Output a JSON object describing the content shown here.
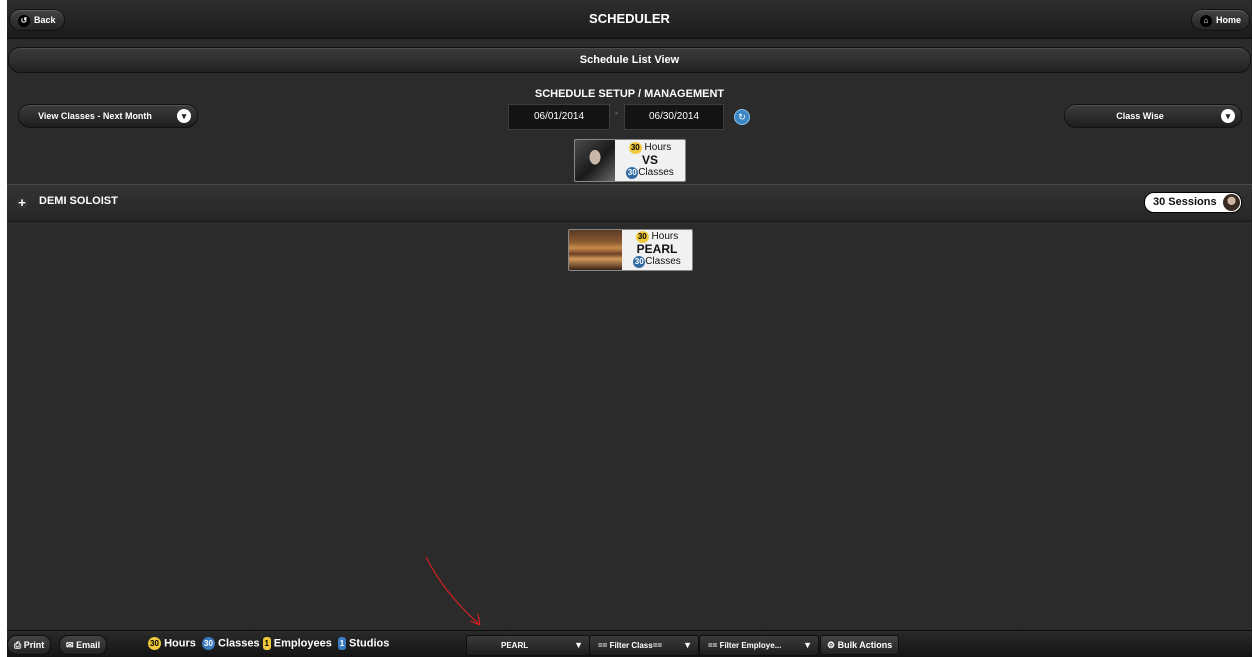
{
  "header": {
    "title": "SCHEDULER",
    "back_label": "Back",
    "home_label": "Home"
  },
  "list_view": {
    "label": "Schedule List View"
  },
  "setup": {
    "title": "SCHEDULE SETUP / MANAGEMENT",
    "view_select": "View Classes - Next Month",
    "date_from": "06/01/2014",
    "date_to": "06/30/2014",
    "date_separator": "-",
    "group_select": "Class Wise"
  },
  "summary_card": {
    "hours_num": "30",
    "hours_label": "Hours",
    "name": "VS",
    "classes_num": "30",
    "classes_label": "Classes"
  },
  "group": {
    "title": "DEMI SOLOIST",
    "sessions": "30 Sessions"
  },
  "studio_card": {
    "hours_num": "30",
    "hours_label": "Hours",
    "name": "PEARL",
    "classes_num": "30",
    "classes_label": "Classes"
  },
  "footer": {
    "print_label": "Print",
    "email_label": "Email",
    "stats": [
      {
        "num": "30",
        "label": "Hours",
        "color": "#f0c93c"
      },
      {
        "num": "30",
        "label": "Classes",
        "color": "#3a7bbf"
      },
      {
        "num": "1",
        "label": "Employees",
        "color": "#f0c93c"
      },
      {
        "num": "1",
        "label": "Studios",
        "color": "#3a7bbf"
      }
    ],
    "filter_studio": "PEARL",
    "filter_class": "== Filter Class==",
    "filter_employee": "== Filter Employe...",
    "bulk_actions": "Bulk Actions"
  },
  "colors": {
    "background": "#2b2b2b",
    "accent": "#3c86c4",
    "badge_yellow": "#f0c93c"
  }
}
